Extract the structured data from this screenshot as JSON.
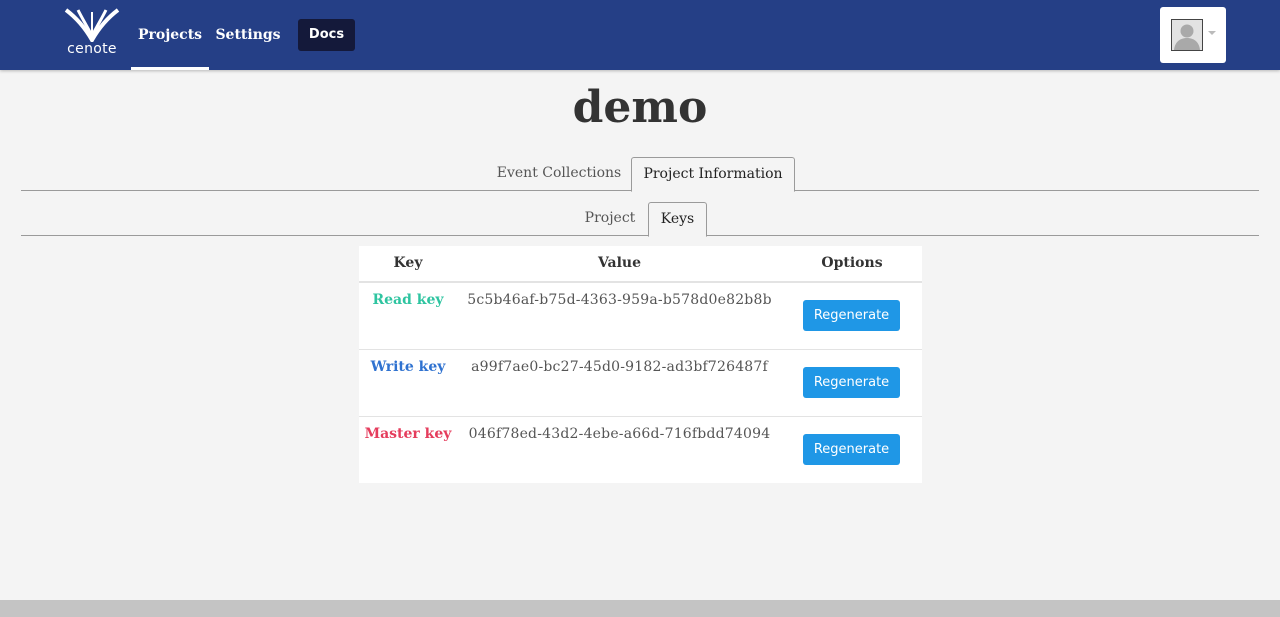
{
  "app": {
    "brand": "cenote"
  },
  "nav": {
    "projects_label": "Projects",
    "settings_label": "Settings",
    "docs_label": "Docs"
  },
  "page": {
    "title": "demo"
  },
  "main_tabs": [
    {
      "label": "Event Collections",
      "active": false
    },
    {
      "label": "Project Information",
      "active": true
    }
  ],
  "sub_tabs": [
    {
      "label": "Project",
      "active": false
    },
    {
      "label": "Keys",
      "active": true
    }
  ],
  "keys_table": {
    "columns": [
      "Key",
      "Value",
      "Options"
    ],
    "rows": [
      {
        "key": "Read key",
        "value": "5c5b46af-b75d-4363-959a-b578d0e82b8b",
        "action": "Regenerate",
        "color": "#2ec4a0"
      },
      {
        "key": "Write key",
        "value": "a99f7ae0-bc27-45d0-9182-ad3bf726487f",
        "action": "Regenerate",
        "color": "#2f72d0"
      },
      {
        "key": "Master key",
        "value": "046f78ed-43d2-4ebe-a66d-716fbdd74094",
        "action": "Regenerate",
        "color": "#e53c5c"
      }
    ]
  },
  "colors": {
    "navbar": "#253f86",
    "docs_button": "#14193a",
    "regenerate_button": "#1f97e6",
    "background": "#f4f4f4"
  },
  "icons": {
    "logo": "cenote-logo",
    "avatar": "user-avatar-icon",
    "menu": "chevron-down-icon"
  }
}
